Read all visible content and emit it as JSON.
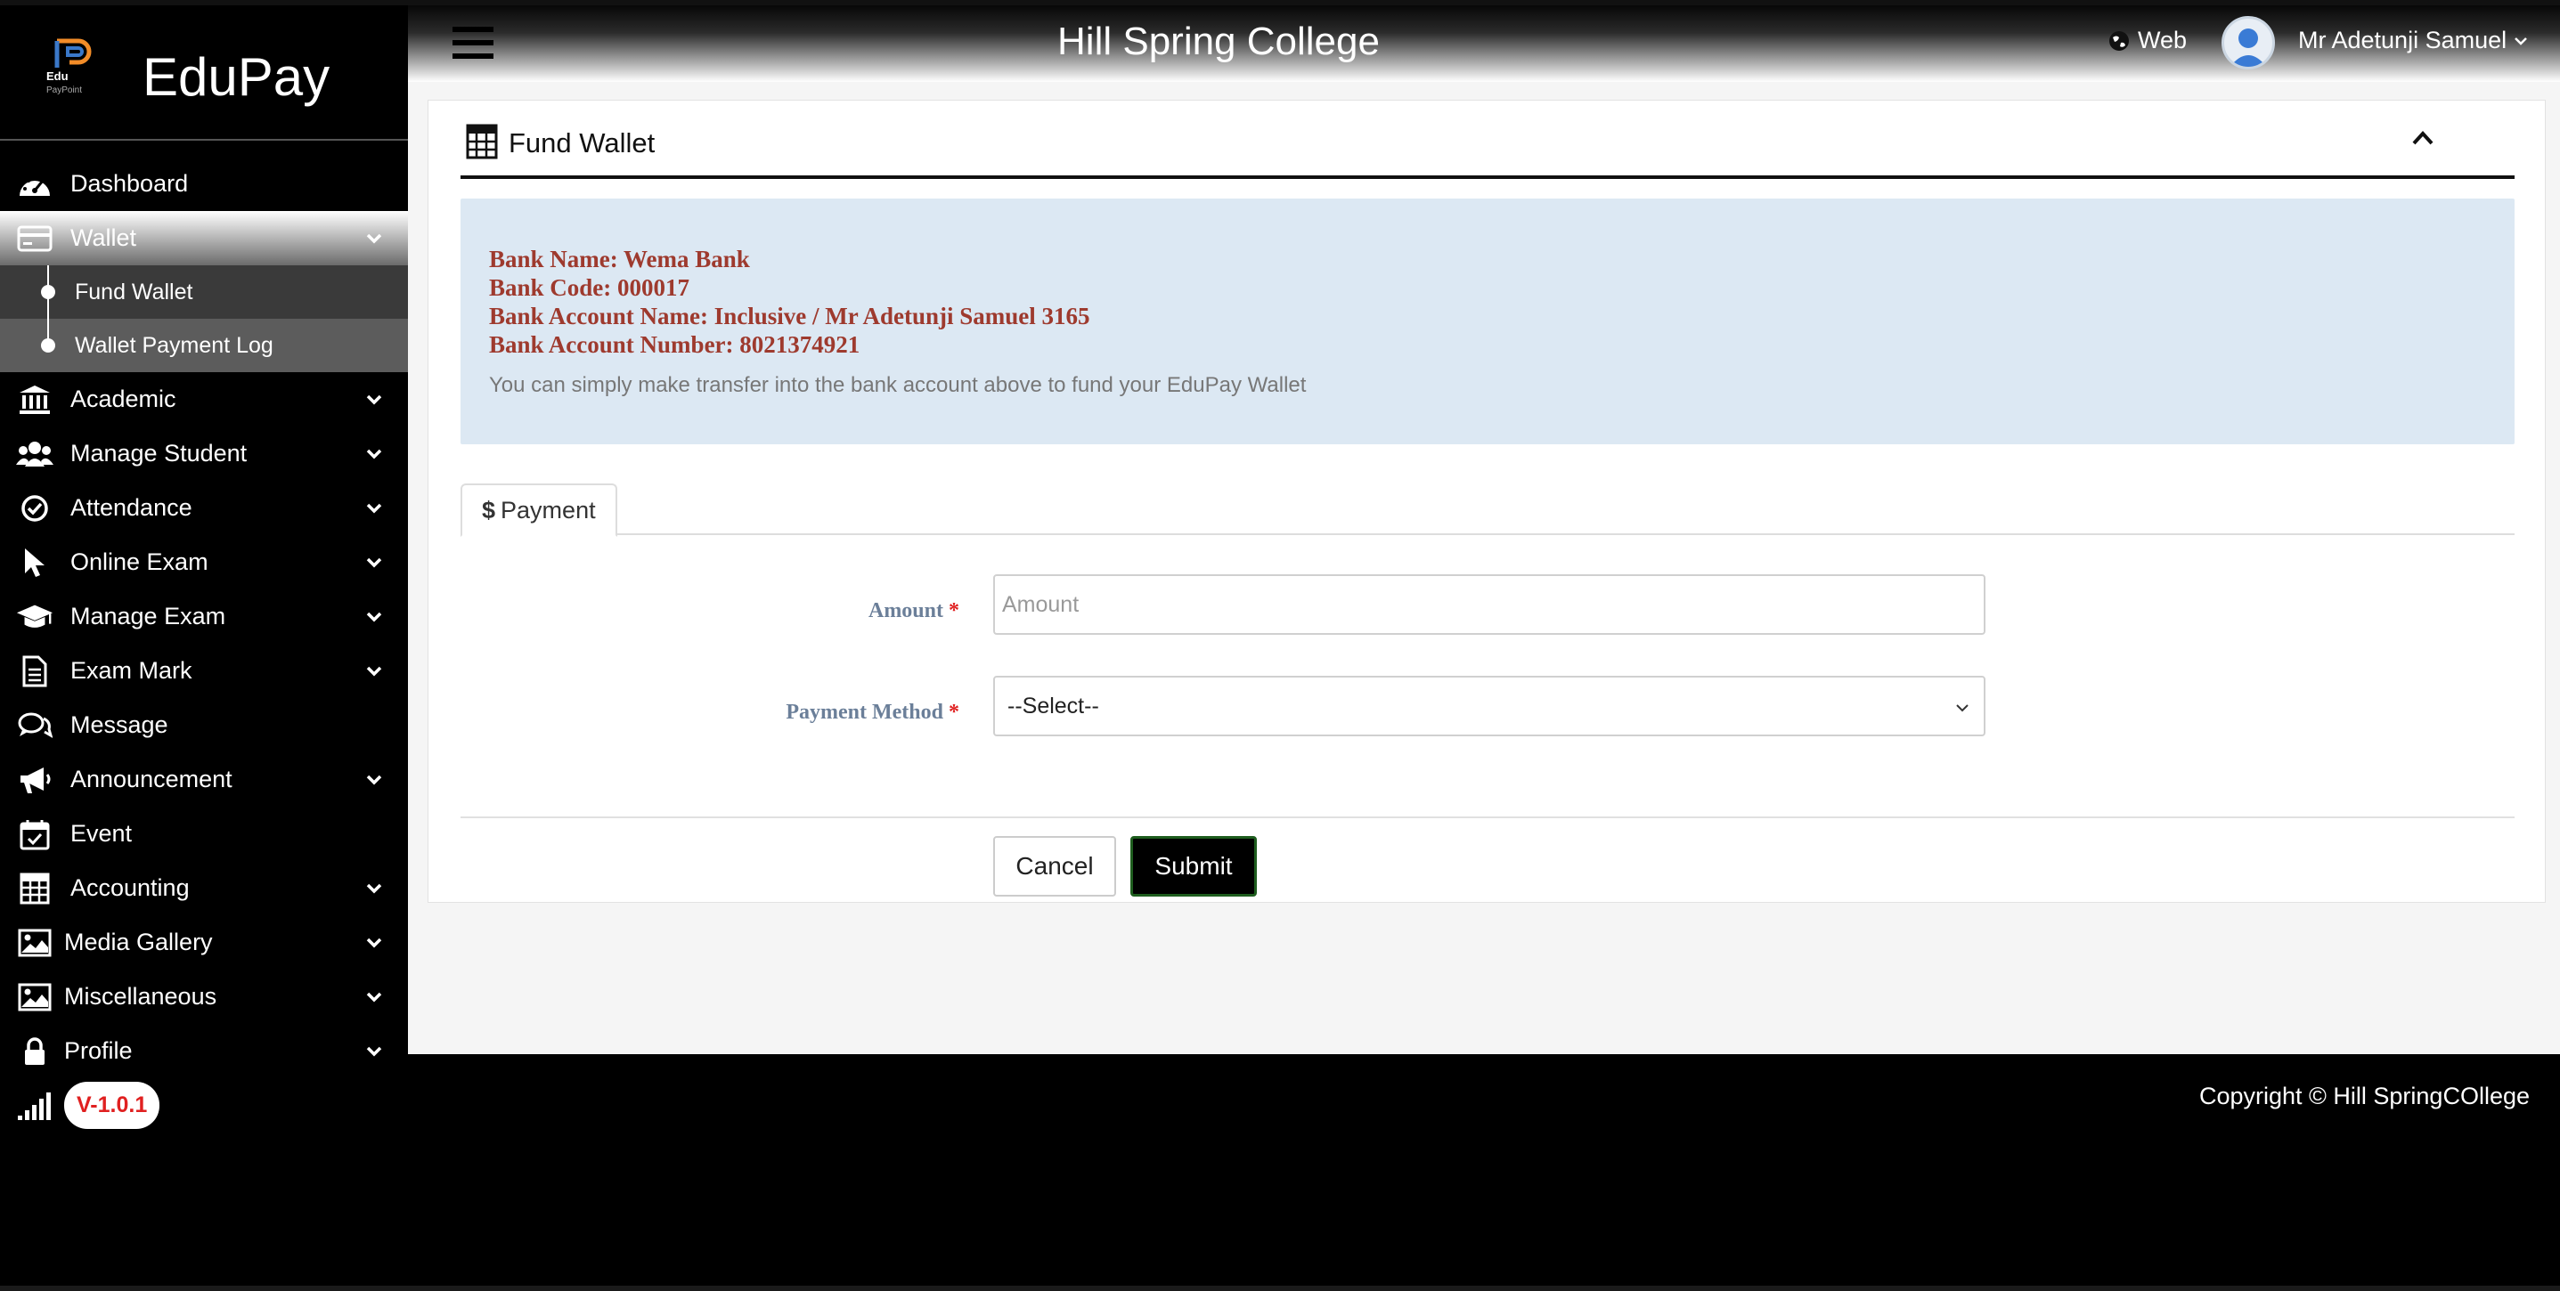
{
  "brand": {
    "name": "EduPay",
    "logo_text_top": "Edu",
    "logo_text_bottom": "PayPoint"
  },
  "header": {
    "title": "Hill Spring College",
    "web_label": "Web",
    "user_name": "Mr Adetunji Samuel"
  },
  "sidebar": {
    "items": [
      {
        "label": "Dashboard",
        "icon": "dashboard-icon"
      },
      {
        "label": "Wallet",
        "icon": "credit-card-icon",
        "expanded": true
      },
      {
        "label": "Academic",
        "icon": "bank-building-icon"
      },
      {
        "label": "Manage Student",
        "icon": "users-icon"
      },
      {
        "label": "Attendance",
        "icon": "check-circle-icon"
      },
      {
        "label": "Online Exam",
        "icon": "mouse-pointer-icon"
      },
      {
        "label": "Manage Exam",
        "icon": "graduation-cap-icon"
      },
      {
        "label": "Exam Mark",
        "icon": "document-icon"
      },
      {
        "label": "Message",
        "icon": "chat-icon"
      },
      {
        "label": "Announcement",
        "icon": "megaphone-icon"
      },
      {
        "label": "Event",
        "icon": "calendar-check-icon"
      },
      {
        "label": "Accounting",
        "icon": "calculator-icon"
      },
      {
        "label": "Media Gallery",
        "icon": "image-icon"
      },
      {
        "label": "Miscellaneous",
        "icon": "image-icon"
      },
      {
        "label": "Profile",
        "icon": "lock-icon"
      }
    ],
    "wallet_sub": [
      {
        "label": "Fund Wallet",
        "current": true
      },
      {
        "label": "Wallet Payment Log",
        "current": false
      }
    ],
    "version": "V-1.0.1"
  },
  "page": {
    "card_title": "Fund Wallet",
    "bank": {
      "name_line": "Bank Name: Wema Bank",
      "code_line": "Bank Code: 000017",
      "account_name_line": "Bank Account Name: Inclusive / Mr Adetunji Samuel 3165",
      "account_number_line": "Bank Account Number: 8021374921",
      "note": "You can simply make transfer into the bank account above to fund your EduPay Wallet"
    },
    "tab_label": "Payment",
    "form": {
      "amount_label": "Amount",
      "amount_placeholder": "Amount",
      "method_label": "Payment Method",
      "method_selected": "--Select--",
      "required_mark": "*"
    },
    "buttons": {
      "cancel": "Cancel",
      "submit": "Submit"
    }
  },
  "footer": {
    "copyright": "Copyright © Hill SpringCOllege"
  },
  "colors": {
    "bank_text": "#9e3a2e",
    "bank_box": "#dce8f3",
    "required": "#e02020",
    "version_text": "#e02020",
    "submit_border": "#1e5d1e"
  }
}
